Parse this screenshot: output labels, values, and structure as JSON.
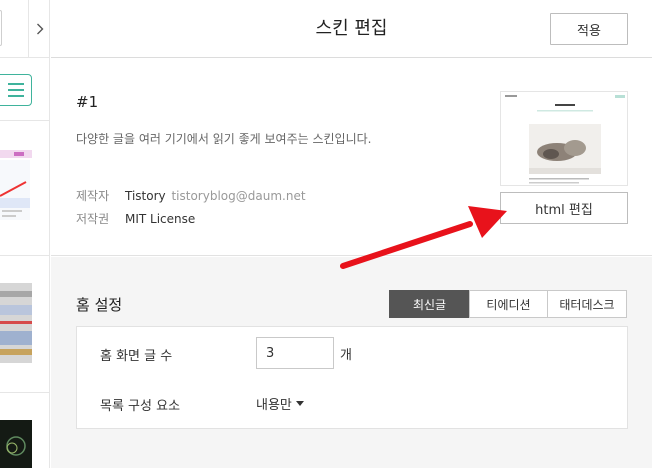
{
  "header": {
    "title": "스킨 편집",
    "apply_label": "적용"
  },
  "skin": {
    "name": "#1",
    "description": "다양한 글을 여러 기기에서 읽기 좋게 보여주는 스킨입니다.",
    "author_label": "제작자",
    "author_name": "Tistory",
    "author_email": "tistoryblog@daum.net",
    "license_label": "저작권",
    "license_value": "MIT License",
    "html_edit_label": "html 편집"
  },
  "home_settings": {
    "title": "홈 설정",
    "tabs": [
      {
        "label": "최신글",
        "active": true
      },
      {
        "label": "티에디션",
        "active": false
      },
      {
        "label": "태터데스크",
        "active": false
      }
    ],
    "post_count_label": "홈 화면 글 수",
    "post_count_value": "3",
    "post_count_unit": "개",
    "list_composition_label": "목록 구성 요소",
    "list_composition_value": "내용만"
  },
  "colors": {
    "accent": "#3fb39c",
    "annotation_arrow": "#e8121b",
    "active_tab": "#555555"
  }
}
